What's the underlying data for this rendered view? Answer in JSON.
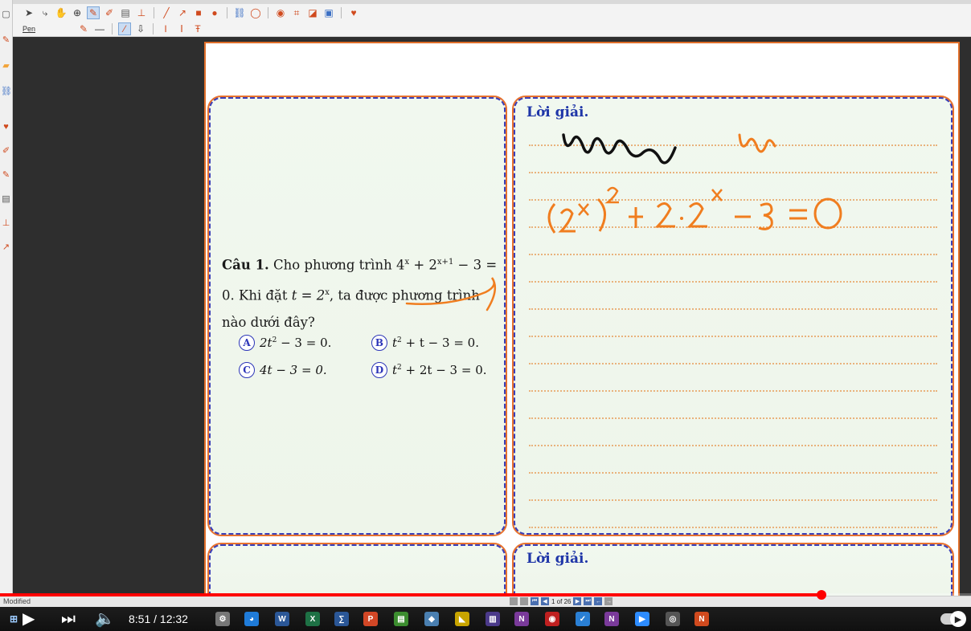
{
  "toolbar": {
    "pen_label": "Pen"
  },
  "question": {
    "label": "Câu 1.",
    "text_a": "Cho phương trình 4",
    "sup_a": "x",
    "text_b": " + 2",
    "sup_b": "x+1",
    "text_c": " − 3 = 0. Khi đặt ",
    "t_eq": "t = 2",
    "sup_c": "x",
    "text_d": ", ta được phương trình nào dưới đây?"
  },
  "options": [
    {
      "letter": "A",
      "pre": "2t",
      "sup": "2",
      "post": " − 3 = 0."
    },
    {
      "letter": "B",
      "pre": "t",
      "sup": "2",
      "post": " + t − 3 = 0."
    },
    {
      "letter": "C",
      "pre": "4t − 3 = 0.",
      "sup": "",
      "post": ""
    },
    {
      "letter": "D",
      "pre": "t",
      "sup": "2",
      "post": " + 2t − 3 = 0."
    }
  ],
  "solution": {
    "title": "Lời giải.",
    "title2": "Lời giải."
  },
  "statusbar": {
    "modified": "Modified",
    "page_counter": "1 of 26"
  },
  "player": {
    "time": "8:51 / 12:32",
    "progress": 0.846
  },
  "colors": {
    "accent_orange": "#e8722e",
    "card_border_blue": "#3a3fb8",
    "solution_title": "#1f36a8",
    "handwriting_orange": "#f07d1f",
    "progress_red": "#ff0000"
  }
}
